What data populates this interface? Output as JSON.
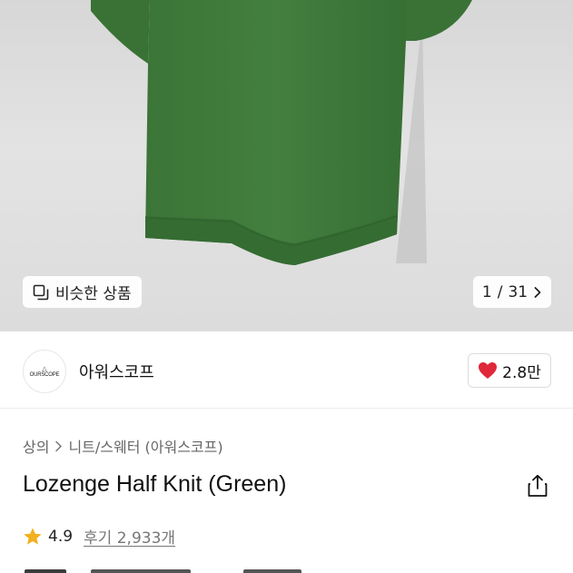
{
  "gallery": {
    "similar_label": "비슷한 상품",
    "page_current": "1",
    "page_total": "31",
    "page_separator": "/"
  },
  "brand": {
    "logo_text": "OURSCOPE",
    "name": "아워스코프",
    "like_count": "2.8만"
  },
  "breadcrumb": {
    "category": "상의",
    "subcategory": "니트/스웨터 (아워스코프)"
  },
  "product": {
    "title": "Lozenge Half Knit (Green)"
  },
  "rating": {
    "score": "4.9",
    "reviews": "후기 2,933개"
  },
  "colors": {
    "knit_green": "#3f7a3c",
    "heart_red": "#e0283a",
    "star_gold": "#f2b01e"
  }
}
